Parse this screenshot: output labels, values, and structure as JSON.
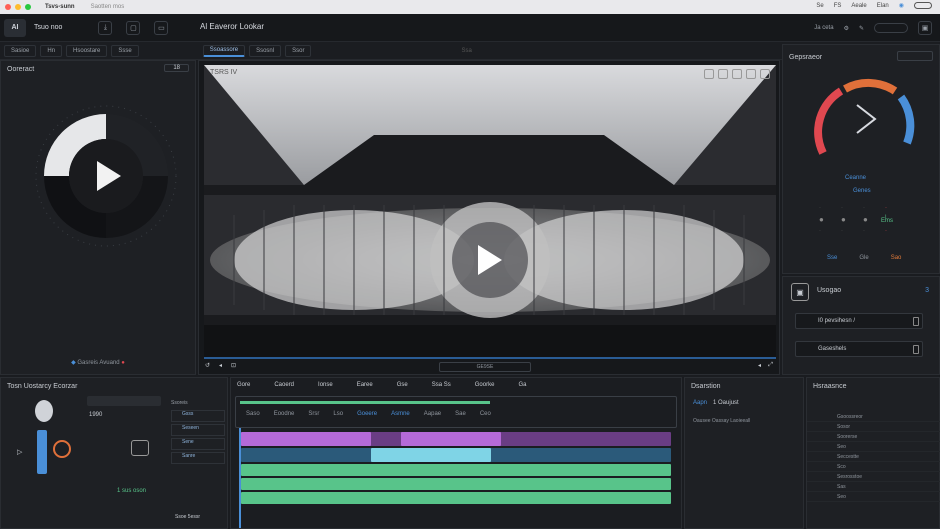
{
  "titlebar": {
    "app_name": "Tsvs-sunn",
    "menu_text": "Saotten mos",
    "right_items": [
      "Se",
      "FS",
      "Aeale",
      "Elan"
    ]
  },
  "appbar": {
    "logo": "AI",
    "project": "Tsuo noo",
    "title": "Al Eaveror Lookar",
    "right_text": "Ja ceta"
  },
  "toolbar": {
    "left_tabs": [
      "Sasioe",
      "Hn",
      "Hsoostare",
      "Ssse"
    ],
    "center_tabs": [
      "Ssoassore",
      "Ssosnl",
      "Ssor"
    ],
    "center_label": "Ssa"
  },
  "left_panel": {
    "title": "Ooreract",
    "value": "18",
    "footer": "Gasreis Avuand"
  },
  "preview": {
    "title": "TSRS IV",
    "timecode": "GE9SE"
  },
  "right_top": {
    "title": "Gepsraeor",
    "label1": "Ceanne",
    "label2": "Genes",
    "value": "Ems",
    "bottom_labels": [
      "Sse",
      "Gle",
      "Sao"
    ]
  },
  "right_mid": {
    "title": "Usogao",
    "value": "3",
    "btn1": "I0 pevsihesn /",
    "btn2": "Gaseshels"
  },
  "bottom_left": {
    "title": "Tosn Uostarcy Ecorzar",
    "value": "1990",
    "value2": "1 sus oson",
    "list_header": "Ssoreis",
    "items": [
      "Gsss",
      "Seseen",
      "Sene",
      "Sanre"
    ],
    "footer": "Ssoe 5essr"
  },
  "timeline": {
    "menu": [
      "Gore",
      "Caoerd",
      "Ionse",
      "Earee",
      "Gse",
      "Ssa Ss",
      "Goorke",
      "Ga"
    ],
    "markers": [
      "Saso",
      "Eoodne",
      "Srsr",
      "Lso",
      "Goeere",
      "Asmne",
      "Aapae",
      "Sae",
      "Ceo"
    ]
  },
  "bottom_mid": {
    "title": "Dsarstion",
    "tabs": [
      "Aapn",
      "1 Oaujust"
    ],
    "desc": "Oausee Oassay Laoieeall"
  },
  "bottom_right": {
    "title": "Hsraasnce",
    "items": [
      "Gsoossreor",
      "Sosor",
      "Soorerse",
      "Seo",
      "Seccestte",
      "Sco",
      "Sesrosstoe",
      "Sas",
      "Seo"
    ]
  },
  "colors": {
    "accent": "#4a8fd8",
    "purple": "#b56ad8",
    "green": "#58c48a",
    "cyan": "#7fd4e6",
    "red": "#e04850"
  }
}
